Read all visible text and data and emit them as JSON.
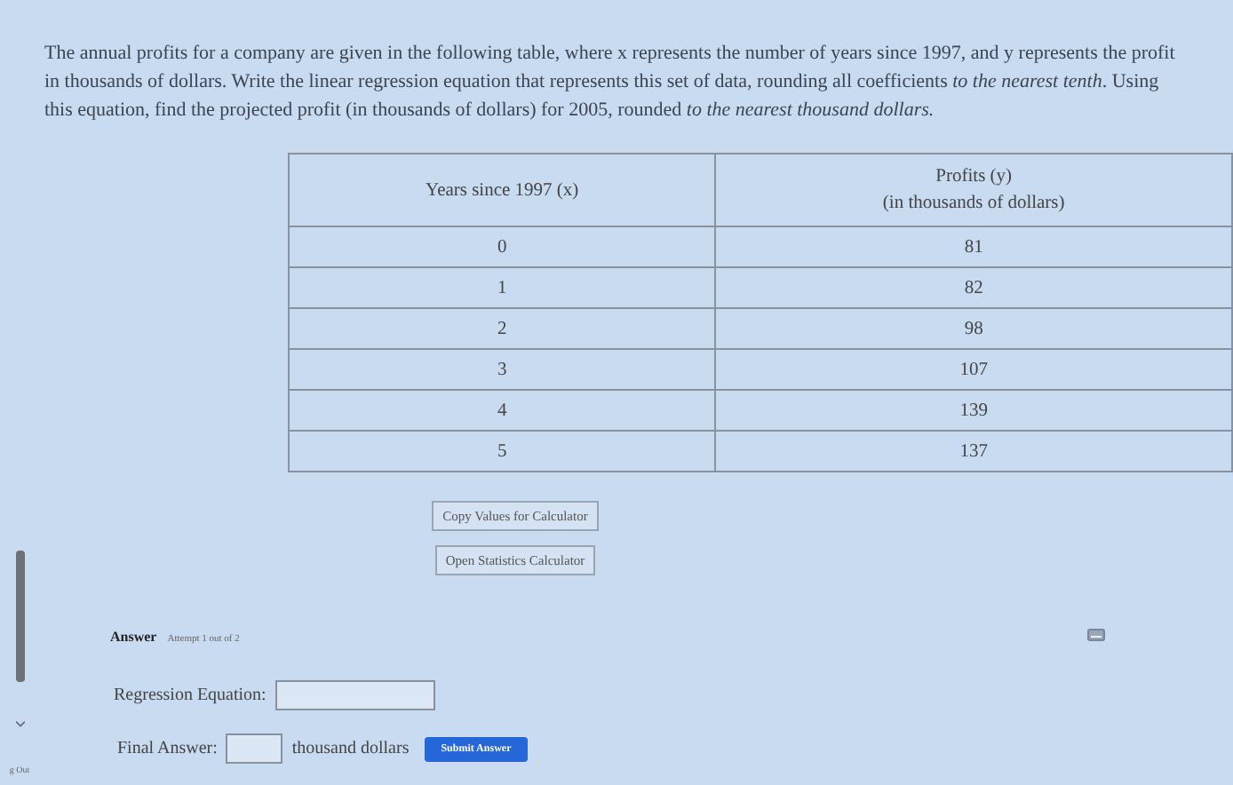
{
  "question": "The annual profits for a company are given in the following table, where x represents the number of years since 1997, and y represents the profit in thousands of dollars. Write the linear regression equation that represents this set of data, rounding all coefficients *to the nearest tenth*. Using this equation, find the projected profit (in thousands of dollars) for 2005, rounded *to the nearest thousand dollars.*",
  "table": {
    "columns": [
      "Years since 1997 (x)",
      "Profits (y)\n(in thousands of dollars)"
    ],
    "rows": [
      [
        "0",
        "81"
      ],
      [
        "1",
        "82"
      ],
      [
        "2",
        "98"
      ],
      [
        "3",
        "107"
      ],
      [
        "4",
        "139"
      ],
      [
        "5",
        "137"
      ]
    ]
  },
  "tools": [
    "Copy Values for Calculator",
    "Open Statistics Calculator"
  ],
  "answer": {
    "heading": "Answer",
    "attempt": "Attempt 1 out of 2",
    "equation_label": "Regression Equation:",
    "final_label": "Final Answer:",
    "unit": "thousand dollars",
    "submit": "Submit Answer"
  },
  "sidebar": {
    "logout": "g Out"
  }
}
